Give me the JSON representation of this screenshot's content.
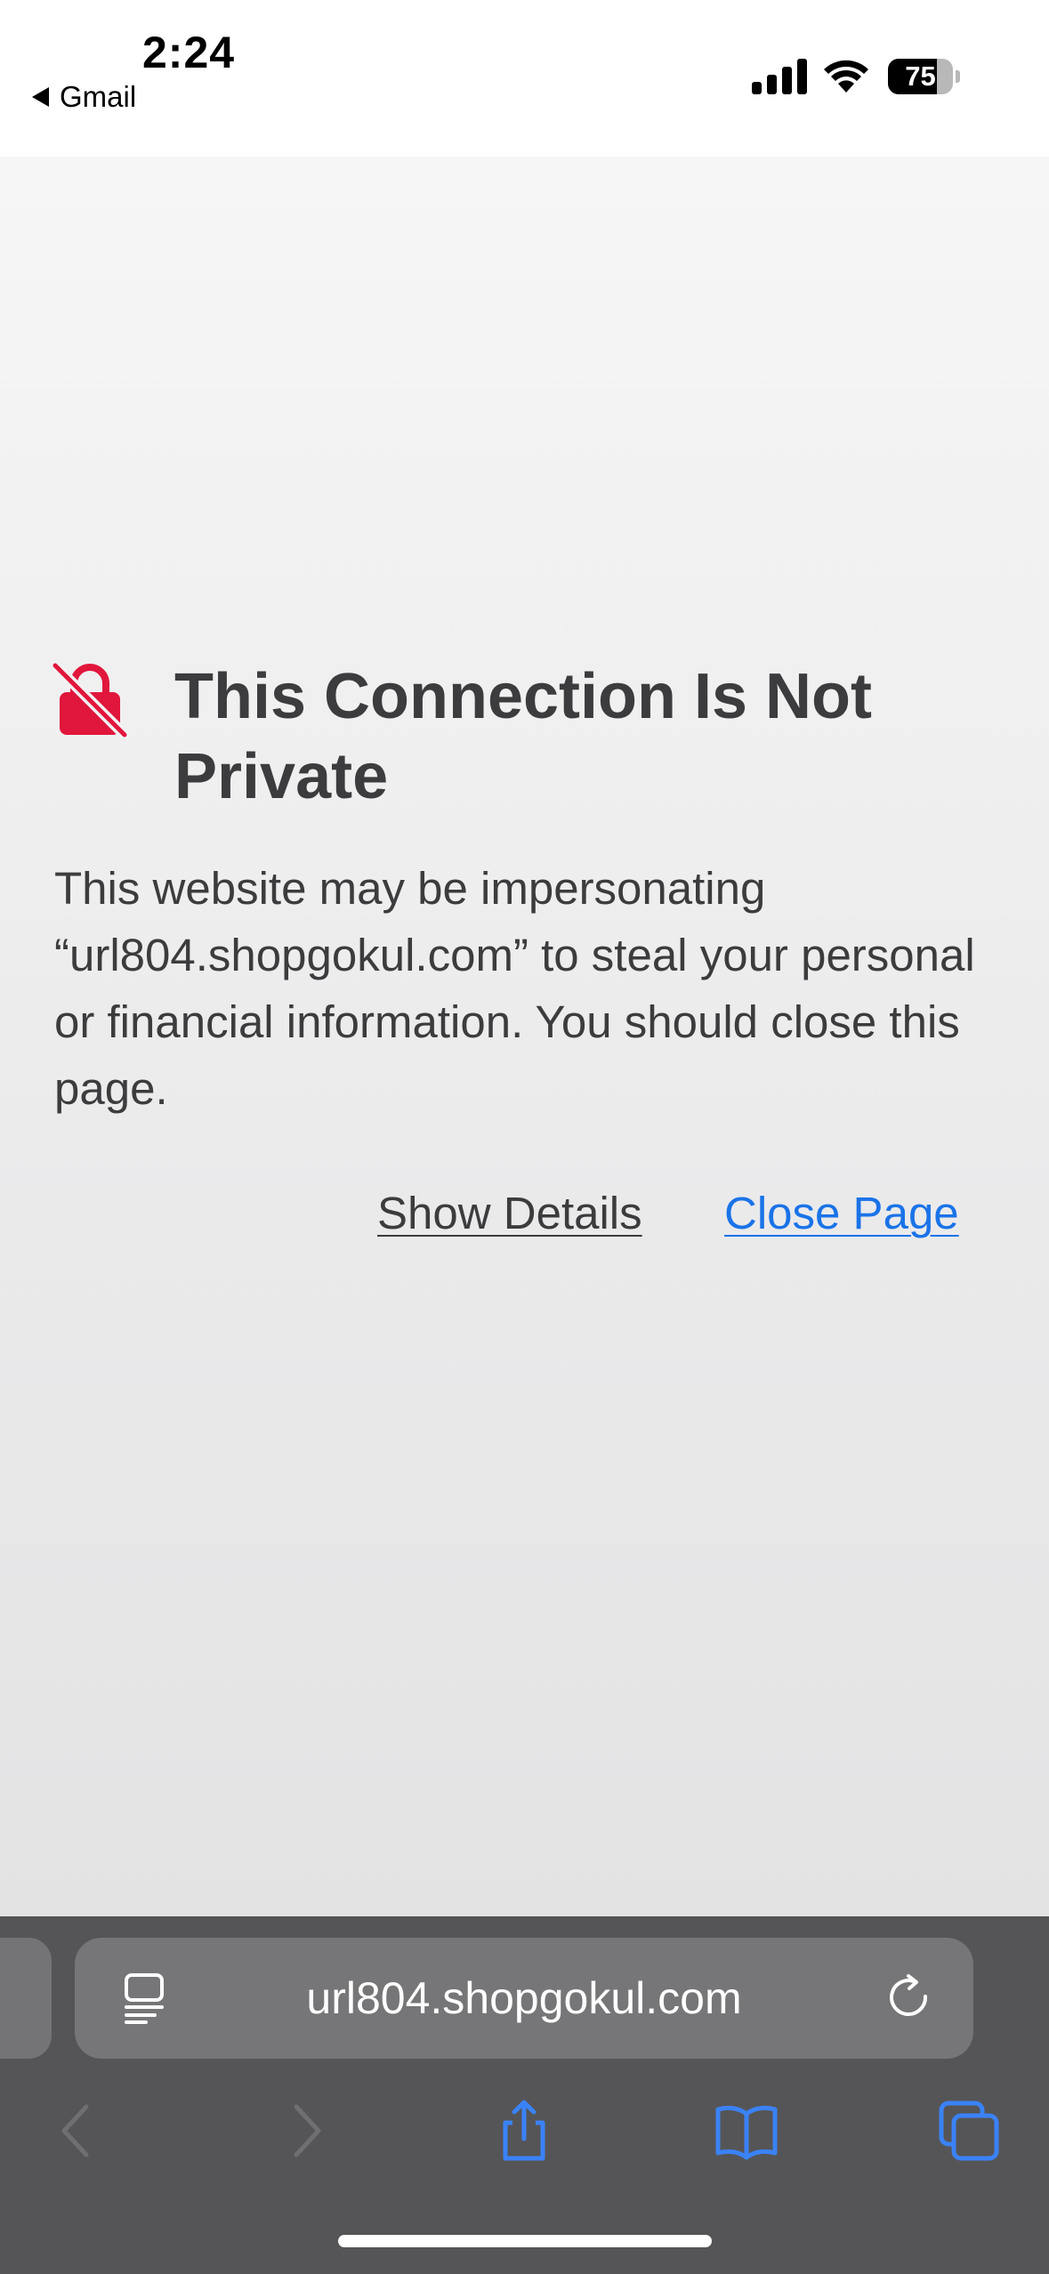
{
  "status_bar": {
    "time": "2:24",
    "back_app": "Gmail",
    "battery_percent": "75",
    "battery_level": 0.75
  },
  "warning": {
    "title": "This Connection Is Not Private",
    "body": "This website may be impersonating “url804.shopgokul.com” to steal your personal or financial information. You should close this page.",
    "show_details": "Show Details",
    "close_page": "Close Page",
    "icon": "lock-slash-icon"
  },
  "address_bar": {
    "url": "url804.shopgokul.com",
    "left_icon": "reader-icon",
    "right_icon": "reload-icon"
  },
  "toolbar": {
    "icons": [
      "back-icon",
      "forward-icon",
      "share-icon",
      "bookmarks-icon",
      "tabs-icon"
    ]
  },
  "colors": {
    "title_text": "#3c3c3e",
    "link_blue": "#1a73e8",
    "lock_red": "#e1163c",
    "toolbar_bg": "#555557",
    "icon_blue": "#3a82f7",
    "icon_disabled": "#6f6f72"
  }
}
